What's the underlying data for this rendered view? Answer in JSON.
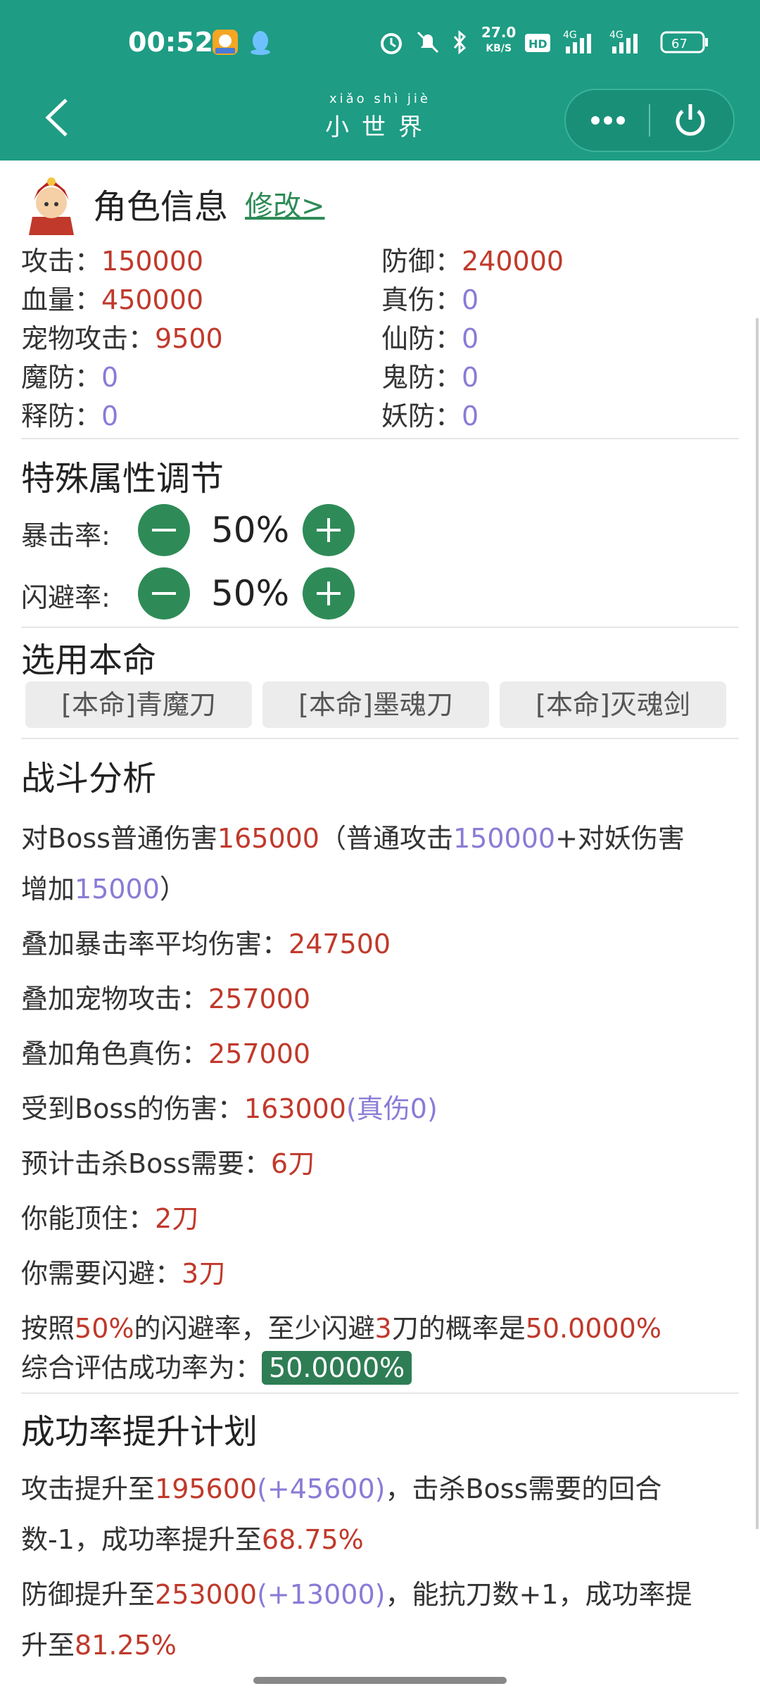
{
  "status_bar": {
    "time": "00:52",
    "net_speed": "27.0",
    "net_unit": "KB/S",
    "battery": "67"
  },
  "nav": {
    "title_pinyin": "xiǎo shì jiè",
    "title": "小世界"
  },
  "role": {
    "title": "角色信息",
    "edit_label": "修改>",
    "stats": [
      {
        "label": "攻击：",
        "value": "150000"
      },
      {
        "label": "防御：",
        "value": "240000"
      },
      {
        "label": "血量：",
        "value": "450000"
      },
      {
        "label": "真伤：",
        "value": "0"
      },
      {
        "label": "宠物攻击：",
        "value": "9500"
      },
      {
        "label": "仙防：",
        "value": "0"
      },
      {
        "label": "魔防：",
        "value": "0"
      },
      {
        "label": "鬼防：",
        "value": "0"
      },
      {
        "label": "释防：",
        "value": "0"
      },
      {
        "label": "妖防：",
        "value": "0"
      }
    ]
  },
  "special": {
    "title": "特殊属性调节",
    "crit_label": "暴击率:",
    "crit_value": "50%",
    "dodge_label": "闪避率:",
    "dodge_value": "50%"
  },
  "weapons": {
    "title": "选用本命",
    "options": [
      "[本命]青魔刀",
      "[本命]墨魂刀",
      "[本命]灭魂剑"
    ]
  },
  "analysis": {
    "title": "战斗分析",
    "l1_a": "对Boss普通伤害",
    "l1_b": "165000",
    "l1_c": "（普通攻击",
    "l1_d": "150000",
    "l1_e": "+对妖伤害",
    "l2_a": "增加",
    "l2_b": "15000",
    "l2_c": "）",
    "l3_a": "叠加暴击率平均伤害：",
    "l3_b": "247500",
    "l4_a": "叠加宠物攻击：",
    "l4_b": "257000",
    "l5_a": "叠加角色真伤：",
    "l5_b": "257000",
    "l6_a": "受到Boss的伤害：",
    "l6_b": "163000",
    "l6_c": "(真伤0)",
    "l7_a": "预计击杀Boss需要：",
    "l7_b": "6刀",
    "l8_a": "你能顶住：",
    "l8_b": "2刀",
    "l9_a": "你需要闪避：",
    "l9_b": "3刀",
    "l10_a": "按照",
    "l10_b": "50%",
    "l10_c": "的闪避率，至少闪避",
    "l10_d": "3",
    "l10_e": "刀的概率是",
    "l10_f": "50.0000%",
    "l11_a": "综合评估成功率为：",
    "l11_b": "50.0000%"
  },
  "plan": {
    "title": "成功率提升计划",
    "p1_a": "攻击提升至",
    "p1_b": "195600",
    "p1_c": "(+45600)",
    "p1_d": "，击杀Boss需要的回合",
    "p2_a": "数-1，成功率提升至",
    "p2_b": "68.75%",
    "p3_a": "防御提升至",
    "p3_b": "253000",
    "p3_c": "(+13000)",
    "p3_d": "，能抗刀数+1，成功率提",
    "p4_a": "升至",
    "p4_b": "81.25%"
  }
}
